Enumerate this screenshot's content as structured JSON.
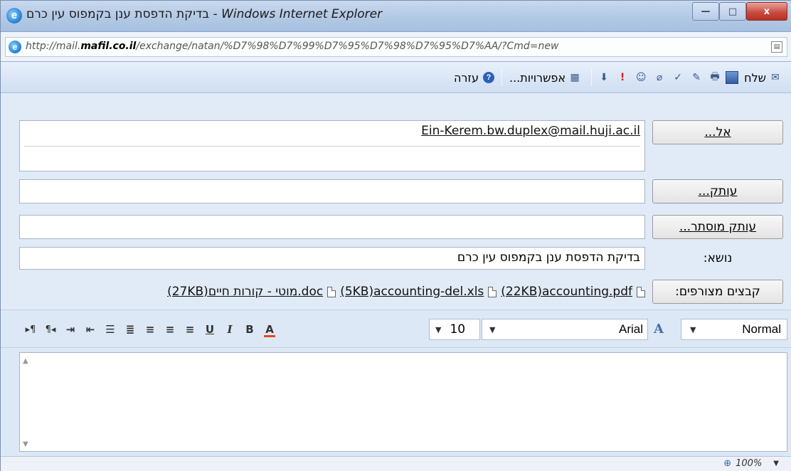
{
  "window": {
    "title": "בדיקת הדפסת ענן בקמפוס עין כרם - ",
    "app_name": "Windows Internet Explorer",
    "minimize_label": "—",
    "maximize_label": "□",
    "close_label": "x"
  },
  "address": {
    "url_prefix": "http://mail.",
    "url_domain": "mafil.co.il",
    "url_suffix": "/exchange/natan/%D7%98%D7%99%D7%95%D7%98%D7%95%D7%AA/?Cmd=new"
  },
  "toolbar": {
    "send_label": "שלח",
    "options_label": "אפשרויות...",
    "help_label": "עזרה",
    "icons": [
      "send-icon",
      "save-icon",
      "print-icon",
      "edit-icon",
      "spellcheck-icon",
      "attach-icon",
      "address-book-icon",
      "high-importance-icon",
      "low-importance-icon",
      "options-icon",
      "help-icon"
    ]
  },
  "form": {
    "to_button": "אל...",
    "to_value": "Ein-Kerem.bw.duplex@mail.huji.ac.il",
    "cc_button": "עותק...",
    "bcc_button": "עותק מוסתר...",
    "subject_label": "נושא:",
    "subject_value": "בדיקת הדפסת ענן בקמפוס עין כרם",
    "attachments_button": "קבצים מצורפים:",
    "attachments": [
      {
        "name": "accounting.pdf",
        "size": "(22KB)"
      },
      {
        "name": "accounting-del.xls",
        "size": "(5KB)"
      },
      {
        "name": "מוטי - קורות חיים.doc",
        "size": "(27KB)"
      }
    ]
  },
  "format": {
    "style_value": "Normal",
    "font_value": "Arial",
    "size_value": "10",
    "bold": "B",
    "italic": "I",
    "underline": "U",
    "color": "A",
    "font_icon": "A"
  },
  "status": {
    "zoom": "100%"
  }
}
